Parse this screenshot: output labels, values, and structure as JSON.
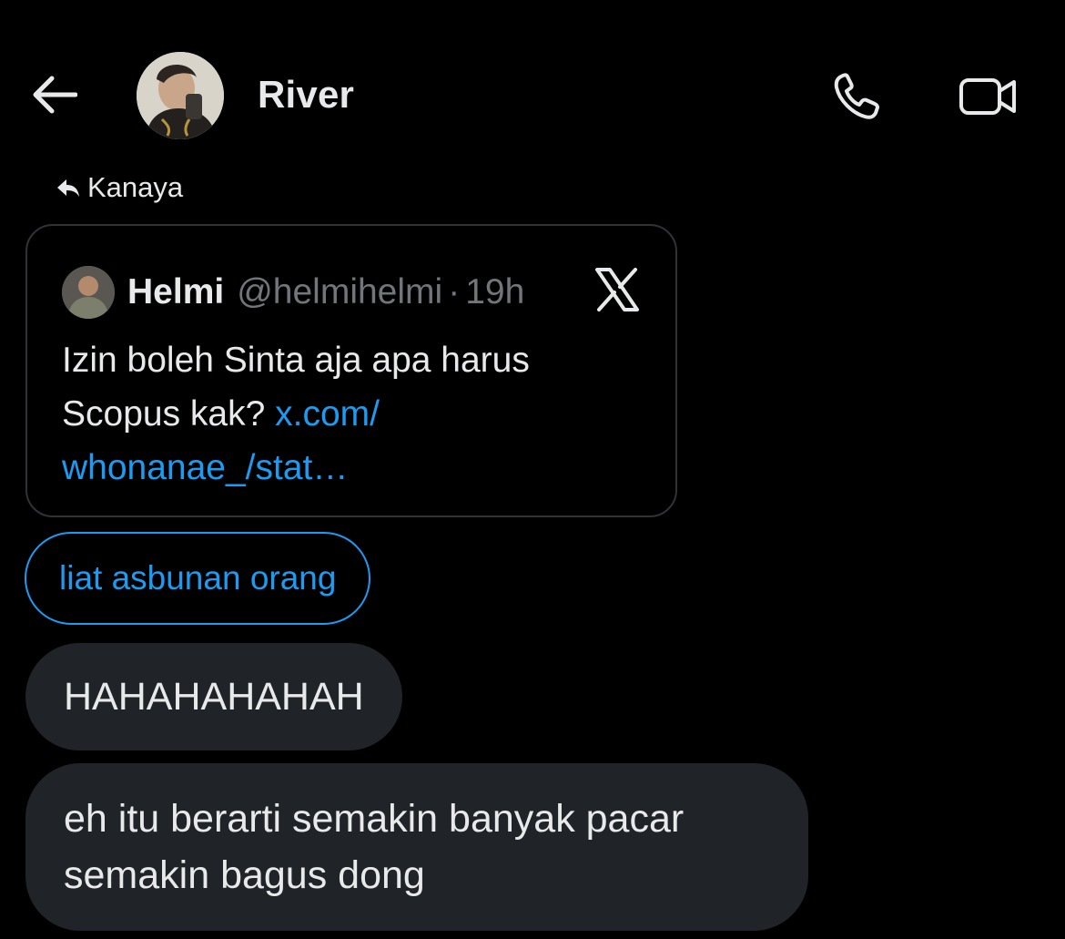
{
  "header": {
    "title": "River",
    "back_icon": "arrow-left-icon",
    "call_icon": "phone-icon",
    "video_icon": "video-camera-icon"
  },
  "reply": {
    "icon": "reply-arrow-icon",
    "label": "Kanaya"
  },
  "quoted_tweet": {
    "name": "Helmi",
    "handle": "@helmihelmi",
    "separator": "·",
    "time": "19h",
    "text": "Izin boleh Sinta aja apa harus Scopus kak?",
    "link": "x.com/ whonanae_/stat…",
    "platform_icon": "x-logo-icon"
  },
  "messages": [
    {
      "text": "liat asbunan orang",
      "style": "outlined"
    },
    {
      "text": "HAHAHAHAHAH",
      "style": "filled"
    },
    {
      "text": "eh itu berarti semakin banyak pacar semakin bagus dong",
      "style": "filled"
    }
  ],
  "colors": {
    "background": "#000000",
    "text": "#e7e9ea",
    "muted": "#71767b",
    "accent": "#1d9bf0",
    "bubble": "#202327",
    "border": "#2f3336"
  }
}
